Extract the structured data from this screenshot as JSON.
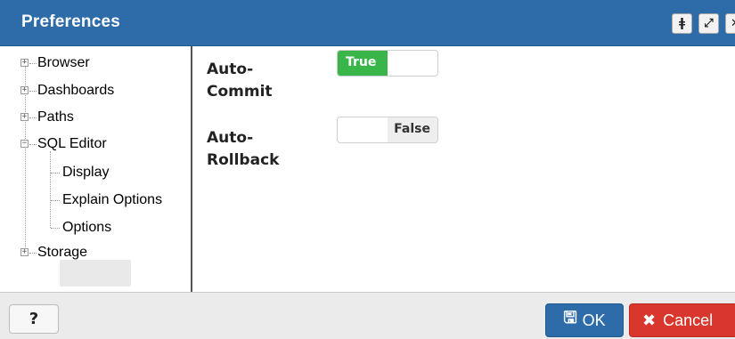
{
  "dialog": {
    "title": "Preferences"
  },
  "titlebar": {
    "pin_icon": "pin-icon",
    "maximize_icon": "maximize-icon",
    "close_icon": "close-icon"
  },
  "tree": {
    "items": [
      {
        "label": "Browser",
        "level": 0,
        "expander": "+"
      },
      {
        "label": "Dashboards",
        "level": 0,
        "expander": "+"
      },
      {
        "label": "Paths",
        "level": 0,
        "expander": "+"
      },
      {
        "label": "SQL Editor",
        "level": 0,
        "expander": "−",
        "expanded": true
      },
      {
        "label": "Display",
        "level": 1
      },
      {
        "label": "Explain Options",
        "level": 1
      },
      {
        "label": "Options",
        "level": 1,
        "selected": true
      },
      {
        "label": "Storage",
        "level": 0,
        "expander": "+"
      }
    ]
  },
  "settings": {
    "auto_commit": {
      "label_line1": "Auto-",
      "label_line2": "Commit",
      "value": "True",
      "on": true
    },
    "auto_rollback": {
      "label_line1": "Auto-",
      "label_line2": "Rollback",
      "value": "False",
      "on": false
    }
  },
  "footer": {
    "help_label": "?",
    "ok_label": "OK",
    "cancel_label": "Cancel",
    "ok_icon": "save-icon",
    "cancel_icon": "x-icon"
  },
  "colors": {
    "titlebar": "#2d6ca8",
    "toggle_on": "#3ab54a",
    "ok": "#2d6ca8",
    "cancel": "#d9372e"
  }
}
